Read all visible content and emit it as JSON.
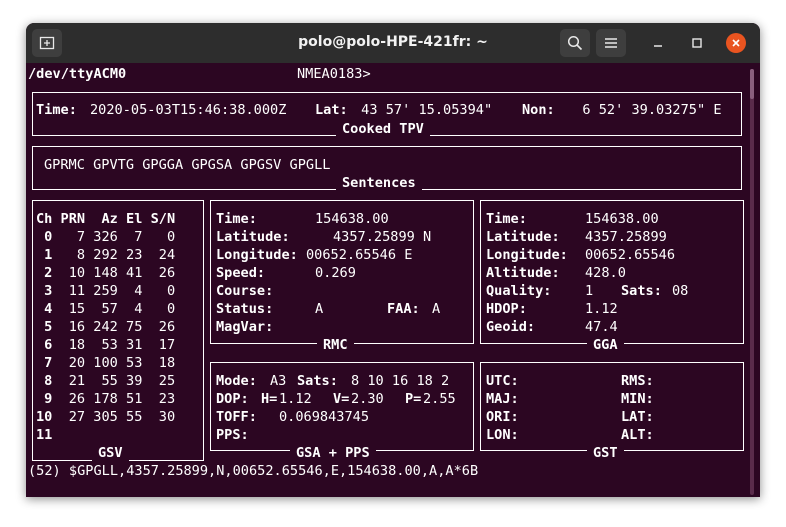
{
  "window": {
    "title": "polo@polo-HPE-421fr: ~"
  },
  "header": {
    "device": "/dev/ttyACM0",
    "protocol": "NMEA0183>"
  },
  "tpv": {
    "label": "Cooked TPV",
    "time_label": "Time:",
    "time_value": "2020-05-03T15:46:38.000Z",
    "lat_label": "Lat:",
    "lat_value": " 43 57' 15.05394\"",
    "lon_label": "Non:",
    "lon_value": "  6 52' 39.03275\" E"
  },
  "sentences": {
    "label": "Sentences",
    "list": "GPRMC GPVTG GPGGA GPGSA GPGSV GPGLL"
  },
  "gsv": {
    "label": "GSV",
    "header": "Ch PRN  Az El S/N",
    "rows": [
      " 0   7 326  7   0",
      " 1   8 292 23  24",
      " 2  10 148 41  26",
      " 3  11 259  4   0",
      " 4  15  57  4   0",
      " 5  16 242 75  26",
      " 6  18  53 31  17",
      " 7  20 100 53  18",
      " 8  21  55 39  25",
      " 9  26 178 51  23",
      "10  27 305 55  30",
      "11"
    ]
  },
  "rmc": {
    "label": "RMC",
    "time_label": "Time:",
    "time_value": "154638.00",
    "lat_label": "Latitude:",
    "lat_value": "4357.25899 N",
    "lon_label": "Longitude:",
    "lon_value": "00652.65546 E",
    "speed_label": "Speed:",
    "speed_value": "0.269",
    "course_label": "Course:",
    "status_label": "Status:",
    "status_value": "A",
    "faa_label": "FAA:",
    "faa_value": "A",
    "magvar_label": "MagVar:"
  },
  "gga": {
    "label": "GGA",
    "time_label": "Time:",
    "time_value": "154638.00",
    "lat_label": "Latitude:",
    "lat_value": "4357.25899",
    "lon_label": "Longitude:",
    "lon_value": "00652.65546",
    "alt_label": "Altitude:",
    "alt_value": "428.0",
    "quality_label": "Quality:",
    "quality_value": "1",
    "sats_label": "Sats:",
    "sats_value": "08",
    "hdop_label": "HDOP:",
    "hdop_value": "1.12",
    "geoid_label": "Geoid:",
    "geoid_value": "47.4"
  },
  "gsa": {
    "label": "GSA + PPS",
    "mode_label": "Mode:",
    "mode_value": "A3",
    "sats_label": "Sats:",
    "sats_value": "8 10 16 18 2",
    "dop_label": "DOP:",
    "h_label": "H=",
    "h_value": "1.12",
    "v_label": "V=",
    "v_value": "2.30",
    "p_label": "P=",
    "p_value": "2.55",
    "toff_label": "TOFF:",
    "toff_value": "0.069843745",
    "pps_label": "PPS:"
  },
  "gst": {
    "label": "GST",
    "utc_label": "UTC:",
    "rms_label": "RMS:",
    "maj_label": "MAJ:",
    "min_label": "MIN:",
    "ori_label": "ORI:",
    "lat_label": "LAT:",
    "lon_label": "LON:",
    "alt_label": "ALT:"
  },
  "raw": "(52) $GPGLL,4357.25899,N,00652.65546,E,154638.00,A,A*6B",
  "colors": {
    "terminal_bg": "#2c0622",
    "titlebar_bg": "#2d2d2d",
    "close_button": "#e95420"
  }
}
